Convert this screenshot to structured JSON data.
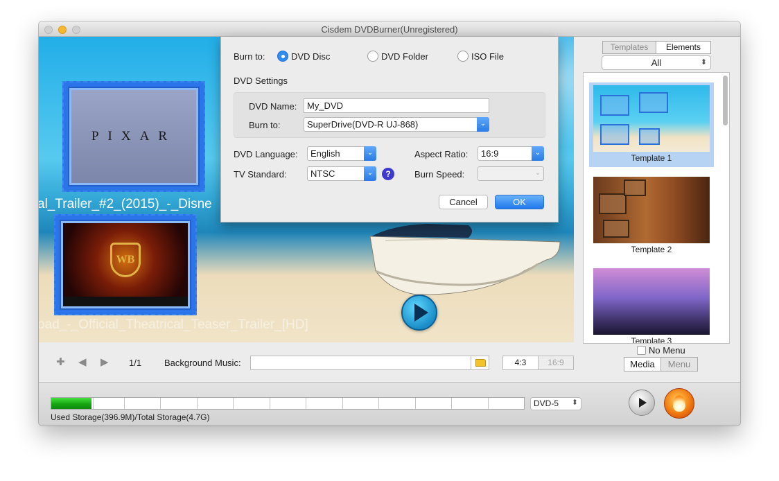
{
  "window": {
    "title": "Cisdem DVDBurner(Unregistered)"
  },
  "preview": {
    "captions": [
      "al_Trailer_#2_(2015)_-_Disne",
      "oad_-_Official_Theatrical_Teaser_Trailer_[HD]"
    ],
    "thumb1_text": "PIXAR",
    "thumb2_text": "WB"
  },
  "dialog": {
    "burn_to_label": "Burn to:",
    "options": [
      "DVD Disc",
      "DVD Folder",
      "ISO File"
    ],
    "selected_option": "DVD Disc",
    "settings_heading": "DVD Settings",
    "dvd_name_label": "DVD Name:",
    "dvd_name_value": "My_DVD",
    "drive_label": "Burn to:",
    "drive_value": "SuperDrive(DVD-R   UJ-868)",
    "language_label": "DVD Language:",
    "language_value": "English",
    "aspect_label": "Aspect Ratio:",
    "aspect_value": "16:9",
    "tv_label": "TV Standard:",
    "tv_value": "NTSC",
    "speed_label": "Burn Speed:",
    "speed_value": "",
    "help_text": "?",
    "cancel_label": "Cancel",
    "ok_label": "OK"
  },
  "toolbar": {
    "page_indicator": "1/1",
    "bg_music_label": "Background Music:",
    "bg_music_value": "",
    "ratio_options": [
      "4:3",
      "16:9"
    ],
    "selected_ratio": "4:3"
  },
  "sidebar": {
    "tabs": [
      "Templates",
      "Elements"
    ],
    "active_tab": "Elements",
    "filter_value": "All",
    "templates": [
      "Template 1",
      "Template 2",
      "Template 3"
    ],
    "selected_template": "Template 1",
    "no_menu_label": "No Menu",
    "no_menu_checked": false,
    "mode_tabs": [
      "Media",
      "Menu"
    ],
    "active_mode": "Media"
  },
  "bottom": {
    "storage_text": "Used Storage(396.9M)/Total Storage(4.7G)",
    "storage_used_fraction": 0.0845,
    "disc_type": "DVD-5"
  },
  "colors": {
    "accent": "#2e8bf5",
    "storage_green": "#17a614"
  },
  "icons": {
    "add": "plus",
    "prev": "left-arrow",
    "next": "right-arrow",
    "folder": "folder",
    "preview": "play",
    "burn": "flame"
  }
}
